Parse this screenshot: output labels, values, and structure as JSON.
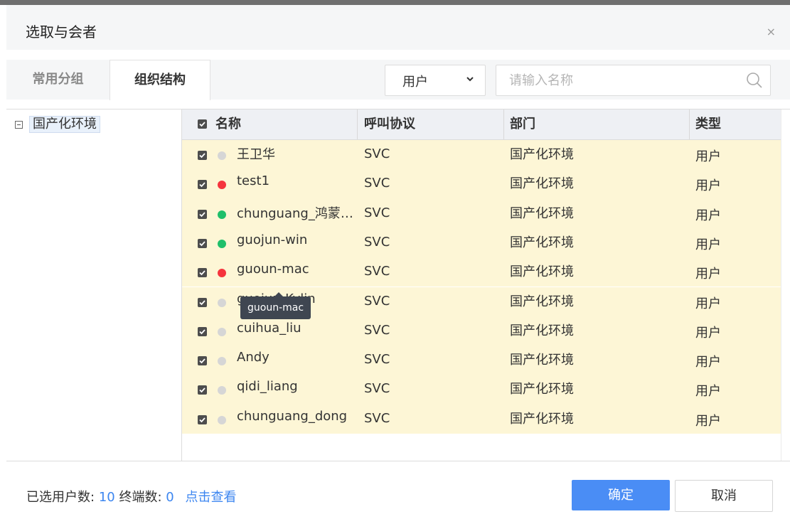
{
  "dialog": {
    "title": "选取与会者",
    "close": "×"
  },
  "tabs": [
    {
      "label": "常用分组",
      "active": false
    },
    {
      "label": "组织结构",
      "active": true
    }
  ],
  "filter": {
    "select_value": "用户",
    "search_placeholder": "请输入名称"
  },
  "tree": {
    "root_label": "国产化环境"
  },
  "table": {
    "headers": [
      "名称",
      "呼叫协议",
      "部门",
      "类型"
    ],
    "rows": [
      {
        "name": "王卫华",
        "status": "gray",
        "protocol": "SVC",
        "dept": "国产化环境",
        "type": "用户"
      },
      {
        "name": "test1",
        "status": "red",
        "protocol": "SVC",
        "dept": "国产化环境",
        "type": "用户"
      },
      {
        "name": "chunguang_鸿蒙…",
        "status": "green",
        "protocol": "SVC",
        "dept": "国产化环境",
        "type": "用户"
      },
      {
        "name": "guojun-win",
        "status": "green",
        "protocol": "SVC",
        "dept": "国产化环境",
        "type": "用户"
      },
      {
        "name": "guoun-mac",
        "status": "red",
        "protocol": "SVC",
        "dept": "国产化环境",
        "type": "用户"
      },
      {
        "name": "guojun-Kylin",
        "status": "gray",
        "protocol": "SVC",
        "dept": "国产化环境",
        "type": "用户"
      },
      {
        "name": "cuihua_liu",
        "status": "gray",
        "protocol": "SVC",
        "dept": "国产化环境",
        "type": "用户"
      },
      {
        "name": "Andy",
        "status": "gray",
        "protocol": "SVC",
        "dept": "国产化环境",
        "type": "用户"
      },
      {
        "name": "qidi_liang",
        "status": "gray",
        "protocol": "SVC",
        "dept": "国产化环境",
        "type": "用户"
      },
      {
        "name": "chunguang_dong",
        "status": "gray",
        "protocol": "SVC",
        "dept": "国产化环境",
        "type": "用户"
      }
    ]
  },
  "tooltip": "guoun-mac",
  "footer": {
    "users_label": "已选用户数:",
    "users_count": "10",
    "terminals_label": "终端数:",
    "terminals_count": "0",
    "view_link": "点击查看",
    "ok_label": "确定",
    "cancel_label": "取消"
  },
  "colors": {
    "accent": "#4a8df5",
    "row_bg": "#fdf6d6",
    "status_red": "#f5343d",
    "status_green": "#1fbf6a",
    "status_gray": "#d6d6d6"
  }
}
